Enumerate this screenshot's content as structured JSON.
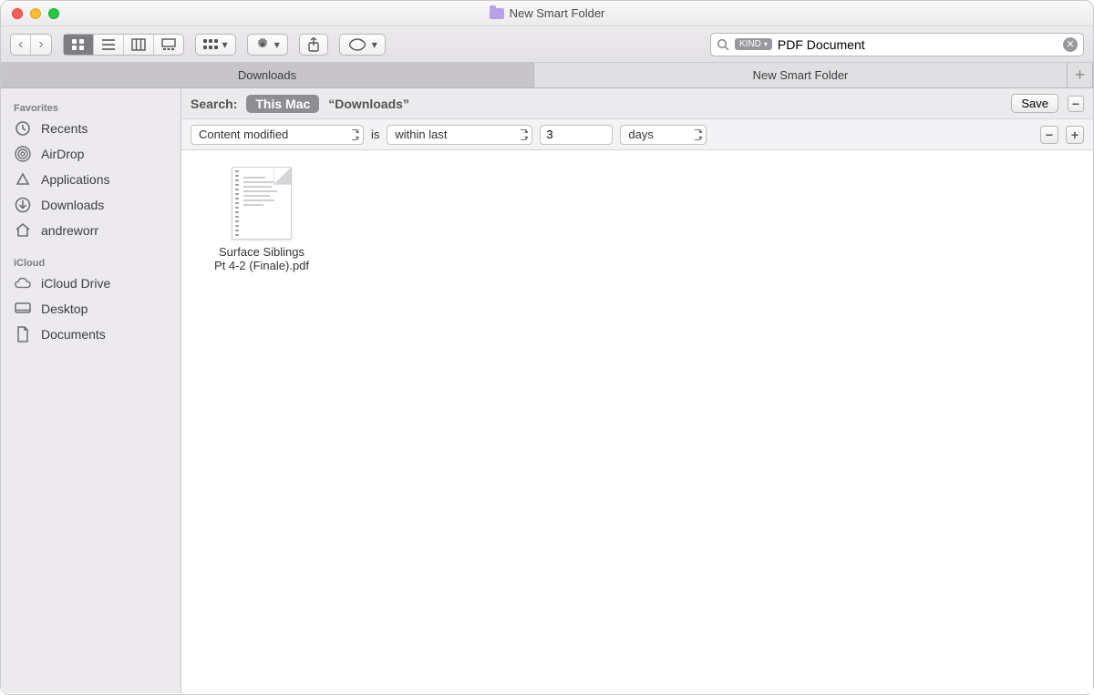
{
  "window": {
    "title": "New Smart Folder"
  },
  "toolbar": {
    "search_token": "KIND",
    "search_text": "PDF Document"
  },
  "tabs": {
    "items": [
      {
        "label": "Downloads",
        "active": false
      },
      {
        "label": "New Smart Folder",
        "active": true
      }
    ]
  },
  "sidebar": {
    "favorites_heading": "Favorites",
    "favorites": [
      {
        "label": "Recents",
        "icon": "clock"
      },
      {
        "label": "AirDrop",
        "icon": "airdrop"
      },
      {
        "label": "Applications",
        "icon": "apps"
      },
      {
        "label": "Downloads",
        "icon": "download"
      },
      {
        "label": "andreworr",
        "icon": "home"
      }
    ],
    "icloud_heading": "iCloud",
    "icloud": [
      {
        "label": "iCloud Drive",
        "icon": "cloud"
      },
      {
        "label": "Desktop",
        "icon": "desktop"
      },
      {
        "label": "Documents",
        "icon": "doc"
      }
    ]
  },
  "scope": {
    "search_label": "Search:",
    "primary": "This Mac",
    "secondary": "“Downloads”",
    "save_label": "Save"
  },
  "criteria": {
    "attribute": "Content modified",
    "is_label": "is",
    "comparator": "within last",
    "value": "3",
    "unit": "days"
  },
  "results": {
    "files": [
      {
        "name_line1": "Surface Siblings",
        "name_line2": "Pt 4-2 (Finale).pdf"
      }
    ]
  }
}
